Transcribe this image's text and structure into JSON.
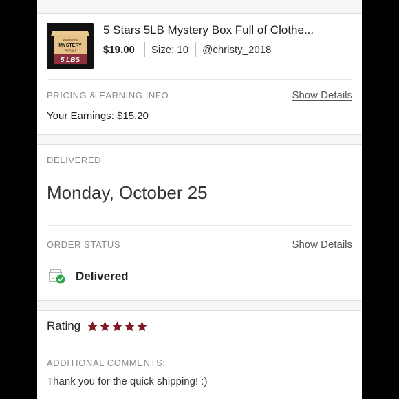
{
  "product": {
    "title": "5 Stars 5LB Mystery Box Full of Clothe...",
    "price": "$19.00",
    "size": "Size: 10",
    "seller": "@christy_2018",
    "thumb": {
      "line1": "Women's",
      "line2": "MYSTERY",
      "line3": "BOX!",
      "line4": "5 LBS"
    }
  },
  "pricing": {
    "label": "PRICING & EARNING INFO",
    "show_details": "Show Details",
    "earnings": "Your Earnings: $15.20"
  },
  "delivery": {
    "label": "DELIVERED",
    "date": "Monday, October 25"
  },
  "order_status": {
    "label": "ORDER STATUS",
    "show_details": "Show Details",
    "status": "Delivered",
    "icon": "delivered-box-icon",
    "status_color": "#2fa84f"
  },
  "rating": {
    "label": "Rating",
    "stars": 5,
    "max_stars": 5,
    "star_color": "#7f1a26"
  },
  "comments": {
    "label": "ADDITIONAL COMMENTS:",
    "text": "Thank you for the quick shipping! :)"
  }
}
